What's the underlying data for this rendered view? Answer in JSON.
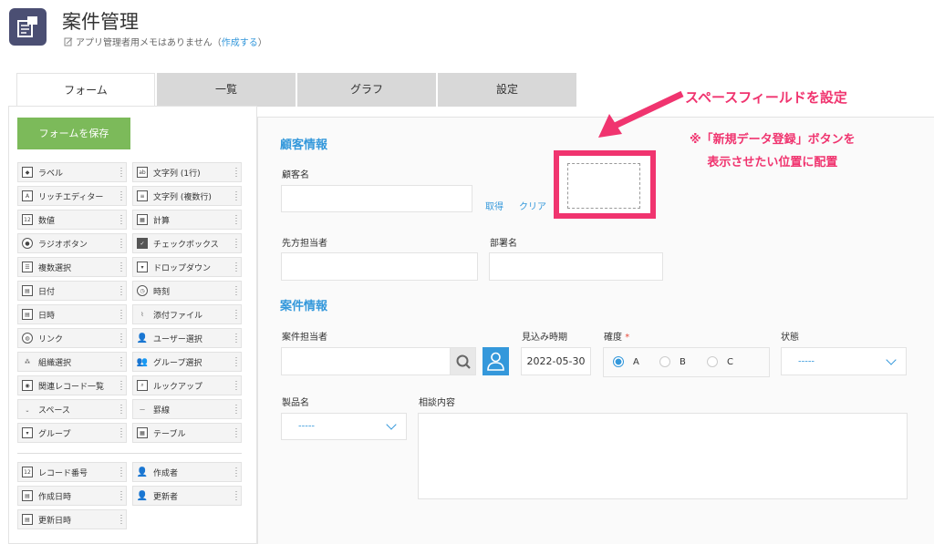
{
  "header": {
    "app_title": "案件管理",
    "memo_text": "アプリ管理者用メモはありません（",
    "memo_link": "作成する",
    "memo_close": "）"
  },
  "tabs": [
    {
      "label": "フォーム",
      "active": true
    },
    {
      "label": "一覧",
      "active": false
    },
    {
      "label": "グラフ",
      "active": false
    },
    {
      "label": "設定",
      "active": false
    }
  ],
  "palette": {
    "save_label": "フォームを保存",
    "items": [
      {
        "label": "ラベル",
        "icon": "tag-icon"
      },
      {
        "label": "文字列 (1行)",
        "icon": "text-single-icon"
      },
      {
        "label": "リッチエディター",
        "icon": "rich-editor-icon"
      },
      {
        "label": "文字列 (複数行)",
        "icon": "text-multi-icon"
      },
      {
        "label": "数値",
        "icon": "number-icon"
      },
      {
        "label": "計算",
        "icon": "calculator-icon"
      },
      {
        "label": "ラジオボタン",
        "icon": "radio-icon"
      },
      {
        "label": "チェックボックス",
        "icon": "checkbox-icon"
      },
      {
        "label": "複数選択",
        "icon": "multi-select-icon"
      },
      {
        "label": "ドロップダウン",
        "icon": "dropdown-icon"
      },
      {
        "label": "日付",
        "icon": "calendar-icon"
      },
      {
        "label": "時刻",
        "icon": "clock-icon"
      },
      {
        "label": "日時",
        "icon": "datetime-icon"
      },
      {
        "label": "添付ファイル",
        "icon": "paperclip-icon"
      },
      {
        "label": "リンク",
        "icon": "globe-icon"
      },
      {
        "label": "ユーザー選択",
        "icon": "user-icon"
      },
      {
        "label": "組織選択",
        "icon": "org-icon"
      },
      {
        "label": "グループ選択",
        "icon": "group-icon"
      },
      {
        "label": "関連レコード一覧",
        "icon": "related-records-icon"
      },
      {
        "label": "ルックアップ",
        "icon": "lookup-icon"
      },
      {
        "label": "スペース",
        "icon": "space-icon"
      },
      {
        "label": "罫線",
        "icon": "line-icon"
      },
      {
        "label": "グループ",
        "icon": "group-field-icon"
      },
      {
        "label": "テーブル",
        "icon": "table-icon"
      }
    ],
    "system_items": [
      {
        "label": "レコード番号",
        "icon": "record-number-icon"
      },
      {
        "label": "作成者",
        "icon": "creator-icon"
      },
      {
        "label": "作成日時",
        "icon": "created-datetime-icon"
      },
      {
        "label": "更新者",
        "icon": "updater-icon"
      },
      {
        "label": "更新日時",
        "icon": "updated-datetime-icon"
      }
    ]
  },
  "form": {
    "customer_section": "顧客情報",
    "customer_name_label": "顧客名",
    "fetch_link": "取得",
    "clear_link": "クリア",
    "contact_label": "先方担当者",
    "department_label": "部署名",
    "deal_section": "案件情報",
    "deal_owner_label": "案件担当者",
    "expected_date_label": "見込み時期",
    "expected_date_value": "2022-05-30",
    "certainty_label": "確度",
    "required_mark": "*",
    "certainty_options": [
      "A",
      "B",
      "C"
    ],
    "certainty_selected": "A",
    "status_label": "状態",
    "status_value": "-----",
    "product_label": "製品名",
    "product_value": "-----",
    "consultation_label": "相談内容"
  },
  "annotation": {
    "title": "スペースフィールドを設定",
    "note_line1": "※「新規データ登録」ボタンを",
    "note_line2": "表示させたい位置に配置",
    "accent": "#f0346f"
  }
}
